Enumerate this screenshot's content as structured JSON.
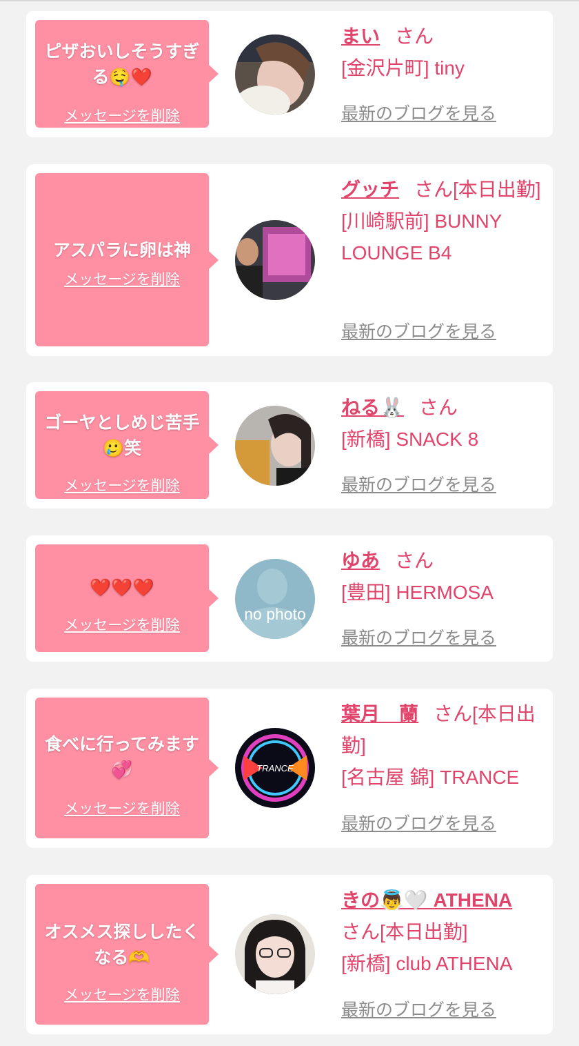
{
  "delete_label": "メッセージを削除",
  "blog_label": "最新のブログを見る",
  "colors": {
    "accent": "#e0446a",
    "bubble": "#ff8fa3",
    "background": "#f2f2f2"
  },
  "cards": [
    {
      "message": "ピザおいしそうすぎる🤤❤️",
      "avatar": "photo",
      "name": "まい",
      "suffix": "さん",
      "shop": "[金沢片町] tiny"
    },
    {
      "message": "アスパラに卵は神",
      "avatar": "photo",
      "name": "グッチ",
      "suffix": "さん[本日出勤]",
      "shop": "[川崎駅前] BUNNY LOUNGE B4"
    },
    {
      "message": "ゴーヤとしめじ苦手🥲笑",
      "avatar": "photo",
      "name": "ねる🐰",
      "suffix": "さん",
      "shop": "[新橋] SNACK 8"
    },
    {
      "message": "❤️❤️❤️",
      "avatar": "no photo",
      "name": "ゆあ",
      "suffix": "さん",
      "shop": "[豊田] HERMOSA"
    },
    {
      "message": "食べに行ってみます💞",
      "avatar": "TRANCE",
      "name": "葉月　蘭",
      "suffix": "さん[本日出勤]",
      "shop": "[名古屋 錦] TRANCE"
    },
    {
      "message": "オスメス探ししたくなる🫶",
      "avatar": "photo",
      "name": "きの👼🤍 ATHENA",
      "suffix": "さん[本日出勤]",
      "shop": "[新橋] club ATHENA"
    }
  ]
}
